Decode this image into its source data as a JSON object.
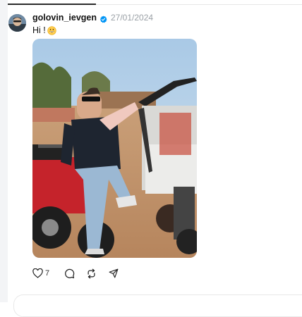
{
  "post": {
    "username": "golovin_ievgen",
    "verified_icon": "verified-badge-icon",
    "date": "27/01/2024",
    "text": "Hi !",
    "emoji_icon": "grinning-face-icon",
    "photo_icon": "photo-man-on-dune-buggy",
    "like_count": "7"
  },
  "actions": {
    "like_icon": "heart-icon",
    "reply_icon": "comment-bubble-icon",
    "repost_icon": "repost-icon",
    "share_icon": "send-icon"
  },
  "colors": {
    "verified_blue": "#0095f6",
    "date_gray": "#9aa0a6",
    "text": "#111111"
  }
}
